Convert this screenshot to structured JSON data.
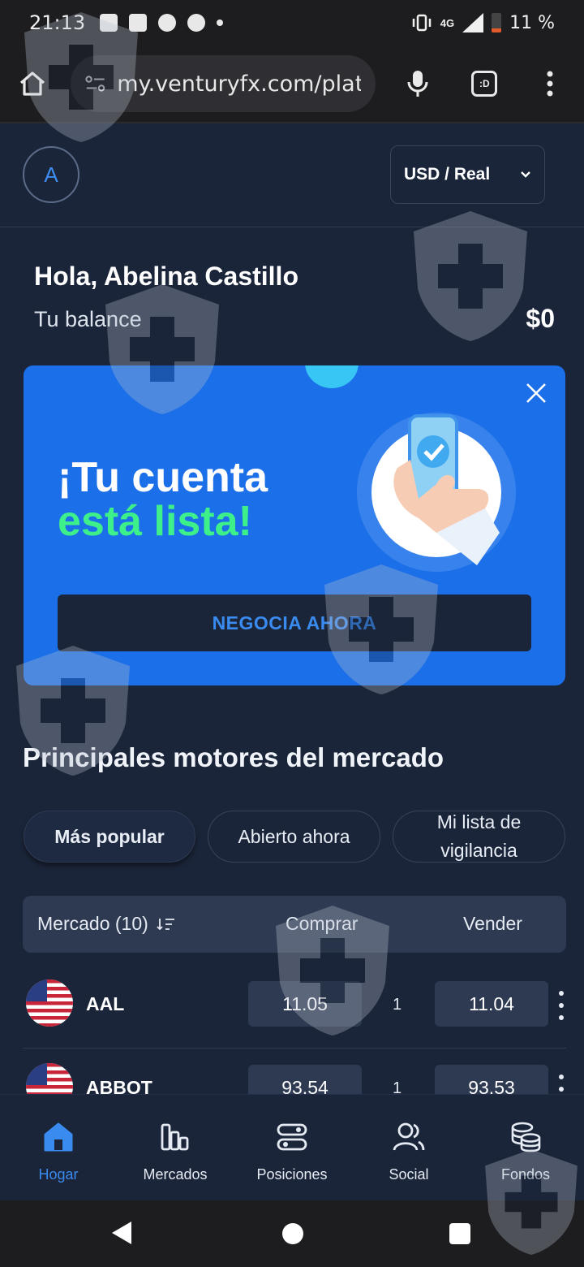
{
  "status_bar": {
    "time": "21:13",
    "network": "4G",
    "battery": "11 %"
  },
  "browser": {
    "url": "my.venturyfx.com/platfo",
    "tabs_label": ":D"
  },
  "header": {
    "avatar_initial": "A",
    "account_selector": "USD / Real"
  },
  "greeting": "Hola, Abelina Castillo",
  "balance": {
    "label": "Tu balance",
    "value": "$0"
  },
  "promo": {
    "title_line1": "¡Tu cuenta",
    "title_line2": "está lista!",
    "cta": "NEGOCIA AHORA",
    "colors": {
      "background": "#1b6fe8",
      "accent": "#3ef08a"
    }
  },
  "markets": {
    "title": "Principales motores del mercado",
    "filters": [
      "Más popular",
      "Abierto ahora",
      "Mi lista de vigilancia"
    ],
    "active_filter": "Más popular",
    "columns": {
      "market": "Mercado (10)",
      "buy": "Comprar",
      "sell": "Vender"
    },
    "rows": [
      {
        "symbol": "AAL",
        "buy": "11.05",
        "qty": "1",
        "sell": "11.04",
        "flag": "us-flag-icon"
      },
      {
        "symbol": "ABBOT",
        "buy": "93.54",
        "qty": "1",
        "sell": "93.53",
        "flag": "us-flag-icon"
      }
    ]
  },
  "bottom_nav": {
    "items": [
      {
        "label": "Hogar",
        "icon": "home-icon",
        "active": true
      },
      {
        "label": "Mercados",
        "icon": "bar-chart-icon"
      },
      {
        "label": "Posiciones",
        "icon": "positions-icon"
      },
      {
        "label": "Social",
        "icon": "users-icon"
      },
      {
        "label": "Fondos",
        "icon": "coins-icon"
      }
    ],
    "active_color": "#3a8bf0"
  }
}
